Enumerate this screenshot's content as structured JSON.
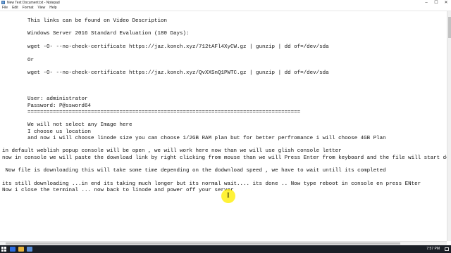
{
  "window": {
    "title": "New Text Document.txt - Notepad",
    "minimize": "–",
    "maximize": "☐",
    "close": "✕"
  },
  "menu": [
    "File",
    "Edit",
    "Format",
    "View",
    "Help"
  ],
  "editor": {
    "lines": [
      "        This links can be found on Video Description",
      "        Windows Server 2016 Standard Evaluation (180 Days):",
      "        wget -O- --no-check-certificate https://jaz.konch.xyz/712tAFl4XyCW.gz | gunzip | dd of=/dev/sda",
      "        Or",
      "        wget -O- --no-check-certificate https://jaz.konch.xyz/QvXXSnQ1PWTC.gz | gunzip | dd of=/dev/sda",
      "        User: administrator",
      "        Password: P@ssword64",
      "        ======================================================================================",
      "        We will not select any Image here",
      "        I choose us location",
      "        and now i will choose linode size you can choose 1/2GB RAM plan but for better perfromance i will choose 4GB Plan",
      "in default weblish popup console will be open , we will work here now than we will use glish console letter",
      "now in console we will paste the download link by right clicking from mouse than we will Press Enter from keyboard and the file will start downlo",
      " Now file is downloading this will take some time depending on the dodwnload speed , we have to wait untill its completed",
      "its still downloading ...in end its taking much longer but its normal wait.... its done .. Now type reboot in console en press ENter",
      "Now i close the terminal ... now back to linode and power off your server"
    ]
  },
  "taskbar": {
    "time": "7:57 PM"
  },
  "colors": {
    "cursor_highlight": "#ffee00",
    "taskbar": "#1b1f26"
  }
}
